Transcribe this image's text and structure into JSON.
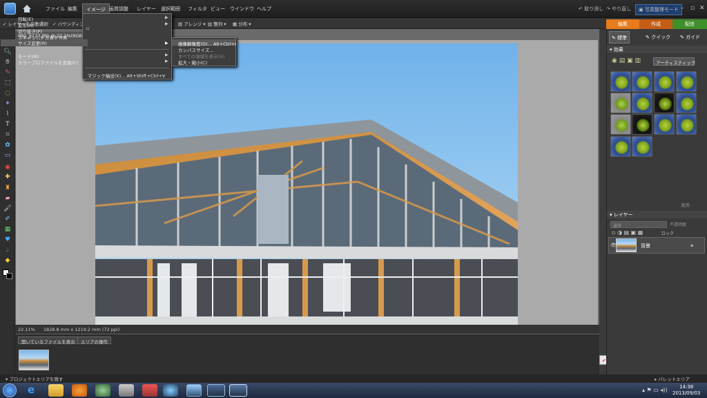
{
  "menubar": {
    "items": [
      "ファイル",
      "編集",
      "イメージ",
      "画質調整",
      "レイヤー",
      "選択範囲",
      "フィルタ",
      "ビュー",
      "ウインドウ",
      "ヘルプ"
    ],
    "undo": "取り消し",
    "redo": "やり直し",
    "organizer": "写真整理モード"
  },
  "options": {
    "auto_select": "レイヤーを自動選択",
    "bounding": "バウンディングボ",
    "arrange": "アレンジ",
    "align": "整列",
    "distribute": "分布"
  },
  "mode_tabs": [
    {
      "label": "編集",
      "color": "#e87b1c"
    },
    {
      "label": "作成",
      "color": "#d0651a"
    },
    {
      "label": "配信",
      "color": "#3f8f2a"
    }
  ],
  "edit_tabs": {
    "full": "標準",
    "quick": "クイック",
    "guided": "ガイド"
  },
  "document": {
    "tab": "IMG_9173.JPG @ 22.1%(RGB/8)",
    "zoom": "22.11%",
    "info": "1828.8 mm x 1219.2 mm (72 ppi)"
  },
  "image_menu": {
    "items": [
      {
        "label": "回転(E)",
        "arrow": true
      },
      {
        "label": "変形(A)",
        "arrow": true
      },
      {
        "label": "切り抜き(P)",
        "arrow": false
      },
      {
        "label": "スキャンした写真を分割",
        "arrow": false
      },
      {
        "label": "サイズ変更(R)",
        "arrow": true,
        "selected": true
      },
      {
        "label": "モード(M)",
        "arrow": true
      },
      {
        "label": "カラープロファイルを変換(C)",
        "arrow": true
      },
      {
        "label": "マジック抽出(X)... Alt+Shift+Ctrl+V",
        "arrow": false
      }
    ]
  },
  "resize_submenu": {
    "items": [
      {
        "label": "画像解像度(D)... Alt+Ctrl+I",
        "enabled": true
      },
      {
        "label": "カンバスサイズ...",
        "enabled": true
      },
      {
        "label": "すべての領域を表示(V)",
        "enabled": false
      },
      {
        "label": "拡大・縮小(C)",
        "enabled": true
      }
    ]
  },
  "effects": {
    "header": "効果",
    "filter": "アーティスティック",
    "apply": "適用"
  },
  "layers": {
    "header": "レイヤー",
    "blend": "通常",
    "opacity": "不透明度",
    "lock": "ロック",
    "layer_name": "背景"
  },
  "bin": {
    "dropdown": "開いているファイルを表示",
    "area": "エリアの操作"
  },
  "bottom": {
    "hide_project": "プロジェクトエリアを隠す",
    "palette": "パレットエリア"
  },
  "ime": {
    "mode": "A 般"
  },
  "clock": {
    "time": "14:38",
    "date": "2013/09/03"
  }
}
